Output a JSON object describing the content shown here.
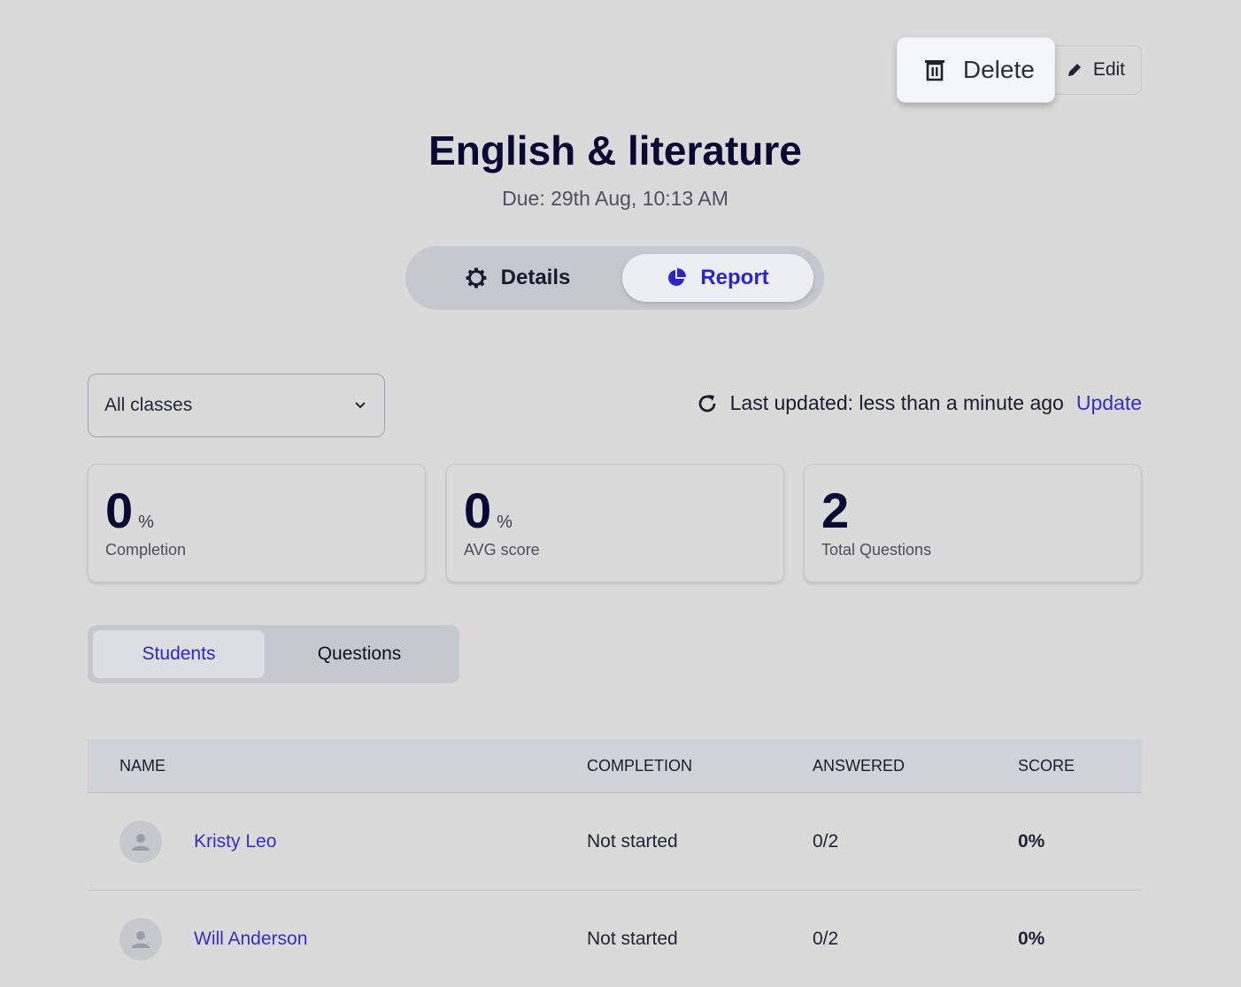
{
  "toolbar": {
    "delete_label": "Delete",
    "edit_label": "Edit"
  },
  "assignment": {
    "title": "English & literature",
    "due": "Due: 29th Aug, 10:13 AM"
  },
  "view_tabs": [
    {
      "label": "Details",
      "icon": "gear-icon",
      "active": false
    },
    {
      "label": "Report",
      "icon": "pie-chart-icon",
      "active": true
    }
  ],
  "filter": {
    "class_select": "All classes",
    "last_updated": "Last updated: less than a minute ago",
    "update_link": "Update"
  },
  "stats": [
    {
      "value": "0",
      "unit": "%",
      "label": "Completion"
    },
    {
      "value": "0",
      "unit": "%",
      "label": "AVG score"
    },
    {
      "value": "2",
      "unit": "",
      "label": "Total Questions"
    }
  ],
  "list_tabs": [
    {
      "label": "Students",
      "active": true
    },
    {
      "label": "Questions",
      "active": false
    }
  ],
  "table": {
    "headers": [
      "NAME",
      "COMPLETION",
      "ANSWERED",
      "SCORE"
    ],
    "rows": [
      {
        "name": "Kristy Leo",
        "completion": "Not started",
        "answered": "0/2",
        "score": "0%"
      },
      {
        "name": "Will Anderson",
        "completion": "Not started",
        "answered": "0/2",
        "score": "0%"
      }
    ]
  },
  "colors": {
    "accent": "#3530c4",
    "background": "#dadada",
    "heading": "#0a0833"
  }
}
